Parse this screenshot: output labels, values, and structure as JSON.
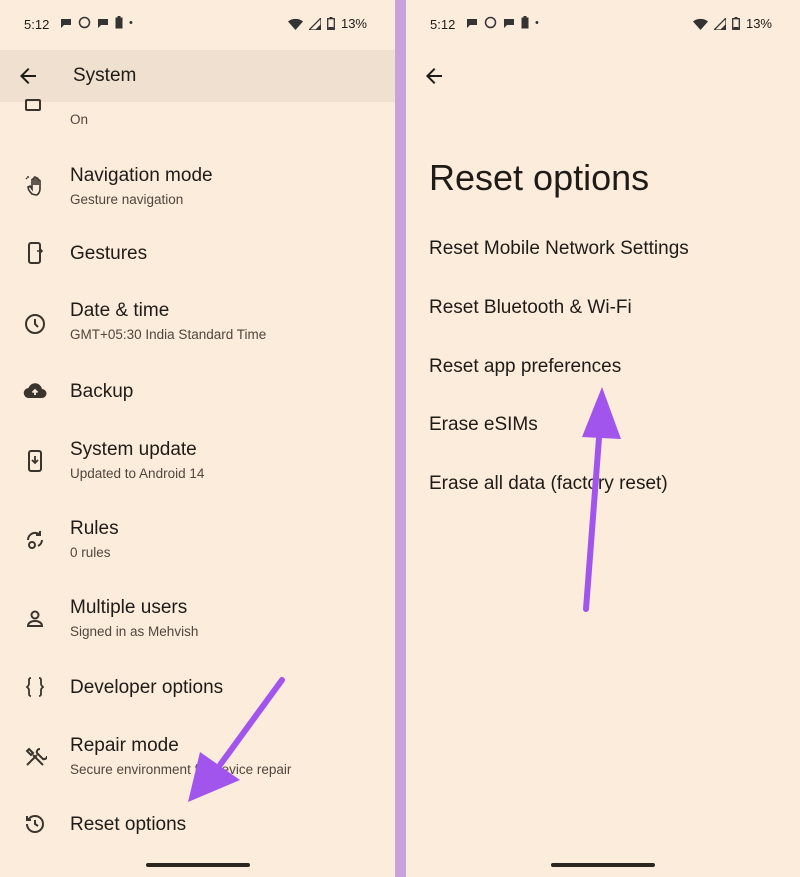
{
  "status_bar": {
    "time": "5:12",
    "battery": "13%"
  },
  "left_screen": {
    "title": "System",
    "items": [
      {
        "title": "",
        "subtitle": "On",
        "icon": "display-icon"
      },
      {
        "title": "Navigation mode",
        "subtitle": "Gesture navigation",
        "icon": "gesture-hand-icon"
      },
      {
        "title": "Gestures",
        "subtitle": "",
        "icon": "phone-gesture-icon"
      },
      {
        "title": "Date & time",
        "subtitle": "GMT+05:30 India Standard Time",
        "icon": "clock-icon"
      },
      {
        "title": "Backup",
        "subtitle": "",
        "icon": "cloud-upload-icon"
      },
      {
        "title": "System update",
        "subtitle": "Updated to Android 14",
        "icon": "system-update-icon"
      },
      {
        "title": "Rules",
        "subtitle": "0 rules",
        "icon": "rules-icon"
      },
      {
        "title": "Multiple users",
        "subtitle": "Signed in as Mehvish",
        "icon": "person-icon"
      },
      {
        "title": "Developer options",
        "subtitle": "",
        "icon": "braces-icon"
      },
      {
        "title": "Repair mode",
        "subtitle": "Secure environment for device repair",
        "icon": "tools-icon"
      },
      {
        "title": "Reset options",
        "subtitle": "",
        "icon": "history-icon"
      }
    ]
  },
  "right_screen": {
    "title": "Reset options",
    "options": [
      "Reset Mobile Network Settings",
      "Reset Bluetooth & Wi-Fi",
      "Reset app preferences",
      "Erase eSIMs",
      "Erase all data (factory reset)"
    ]
  },
  "colors": {
    "background": "#fcecdc",
    "appbar": "#efe0cf",
    "arrow": "#a155ec"
  }
}
